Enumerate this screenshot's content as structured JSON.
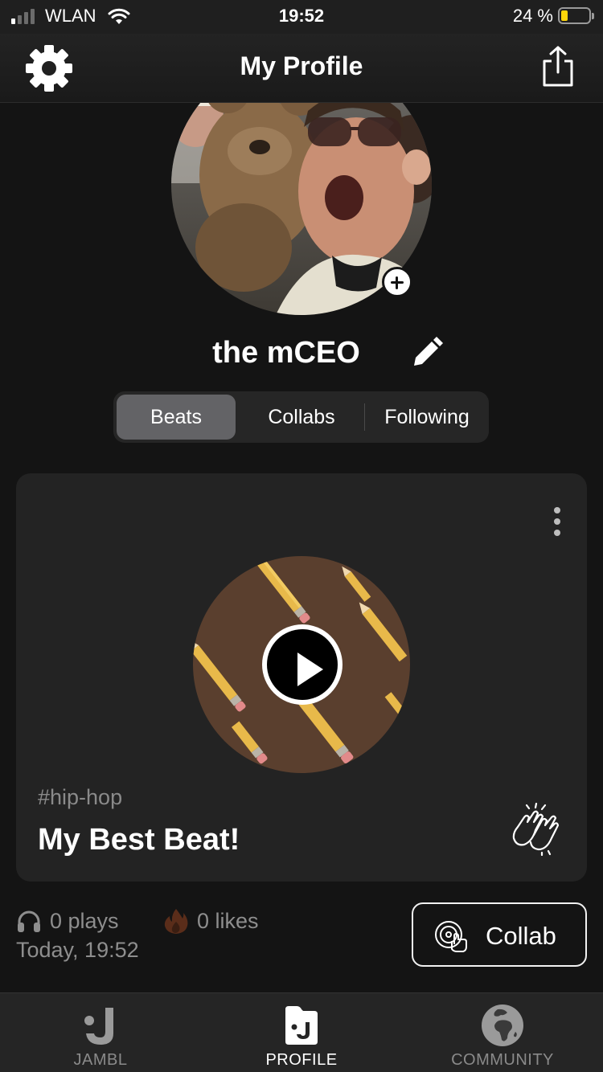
{
  "status_bar": {
    "carrier": "WLAN",
    "time": "19:52",
    "battery_percent": "24 %",
    "battery_level": 0.24,
    "signal_bars_active": 1,
    "signal_bars_total": 4
  },
  "header": {
    "title": "My Profile",
    "settings_icon": "gear-icon",
    "share_icon": "share-icon"
  },
  "profile": {
    "username": "the mCEO",
    "edit_icon": "pencil-icon",
    "avatar_add_icon": "plus-icon"
  },
  "tabs": [
    {
      "label": "Beats",
      "active": true
    },
    {
      "label": "Collabs",
      "active": false
    },
    {
      "label": "Following",
      "active": false
    }
  ],
  "beat": {
    "genre": "#hip-hop",
    "title": "My Best Beat!",
    "plays": "0 plays",
    "likes": "0 likes",
    "timestamp": "Today, 19:52",
    "collab_label": "Collab",
    "icons": {
      "more": "more-vertical-icon",
      "play": "play-icon",
      "clap": "clapping-hands-icon",
      "plays": "headphones-icon",
      "likes": "flame-icon",
      "collab": "vinyl-hand-icon"
    }
  },
  "bottom_nav": [
    {
      "label": "JAMBL",
      "icon": "jambl-logo-icon",
      "active": false
    },
    {
      "label": "PROFILE",
      "icon": "profile-icon",
      "active": true
    },
    {
      "label": "COMMUNITY",
      "icon": "globe-icon",
      "active": false
    }
  ],
  "colors": {
    "background": "#141414",
    "card": "#232323",
    "tab_active": "#636366",
    "battery_fill": "#ffd60a",
    "muted_text": "#8e8e8e"
  }
}
